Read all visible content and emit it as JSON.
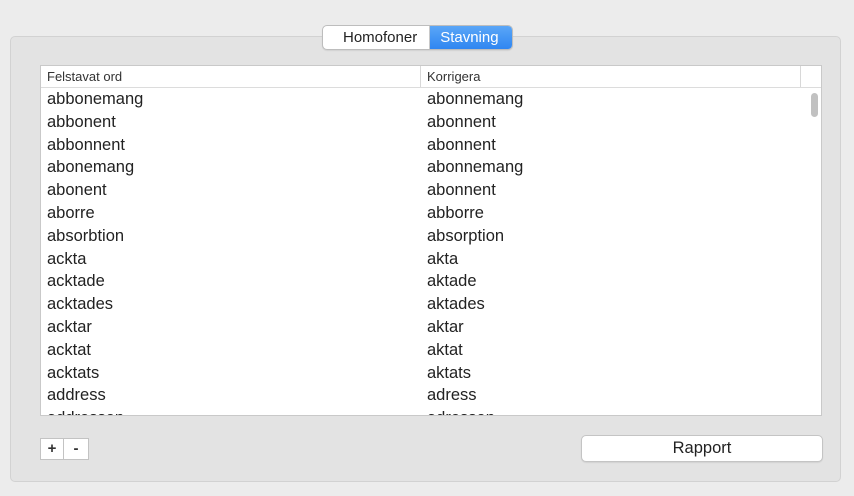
{
  "tabs": {
    "homofoner": "Homofoner",
    "stavning": "Stavning",
    "active": "Stavning"
  },
  "table": {
    "columns": [
      "Felstavat ord",
      "Korrigera"
    ],
    "rows": [
      [
        "abbonemang",
        "abonnemang"
      ],
      [
        "abbonent",
        "abonnent"
      ],
      [
        "abbonnent",
        "abonnent"
      ],
      [
        "abonemang",
        "abonnemang"
      ],
      [
        "abonent",
        "abonnent"
      ],
      [
        "aborre",
        "abborre"
      ],
      [
        "absorbtion",
        "absorption"
      ],
      [
        "ackta",
        "akta"
      ],
      [
        "acktade",
        "aktade"
      ],
      [
        "acktades",
        "aktades"
      ],
      [
        "acktar",
        "aktar"
      ],
      [
        "acktat",
        "aktat"
      ],
      [
        "acktats",
        "aktats"
      ],
      [
        "address",
        "adress"
      ],
      [
        "addressen",
        "adressen"
      ]
    ]
  },
  "buttons": {
    "add": "+",
    "remove": "-",
    "report": "Rapport"
  }
}
